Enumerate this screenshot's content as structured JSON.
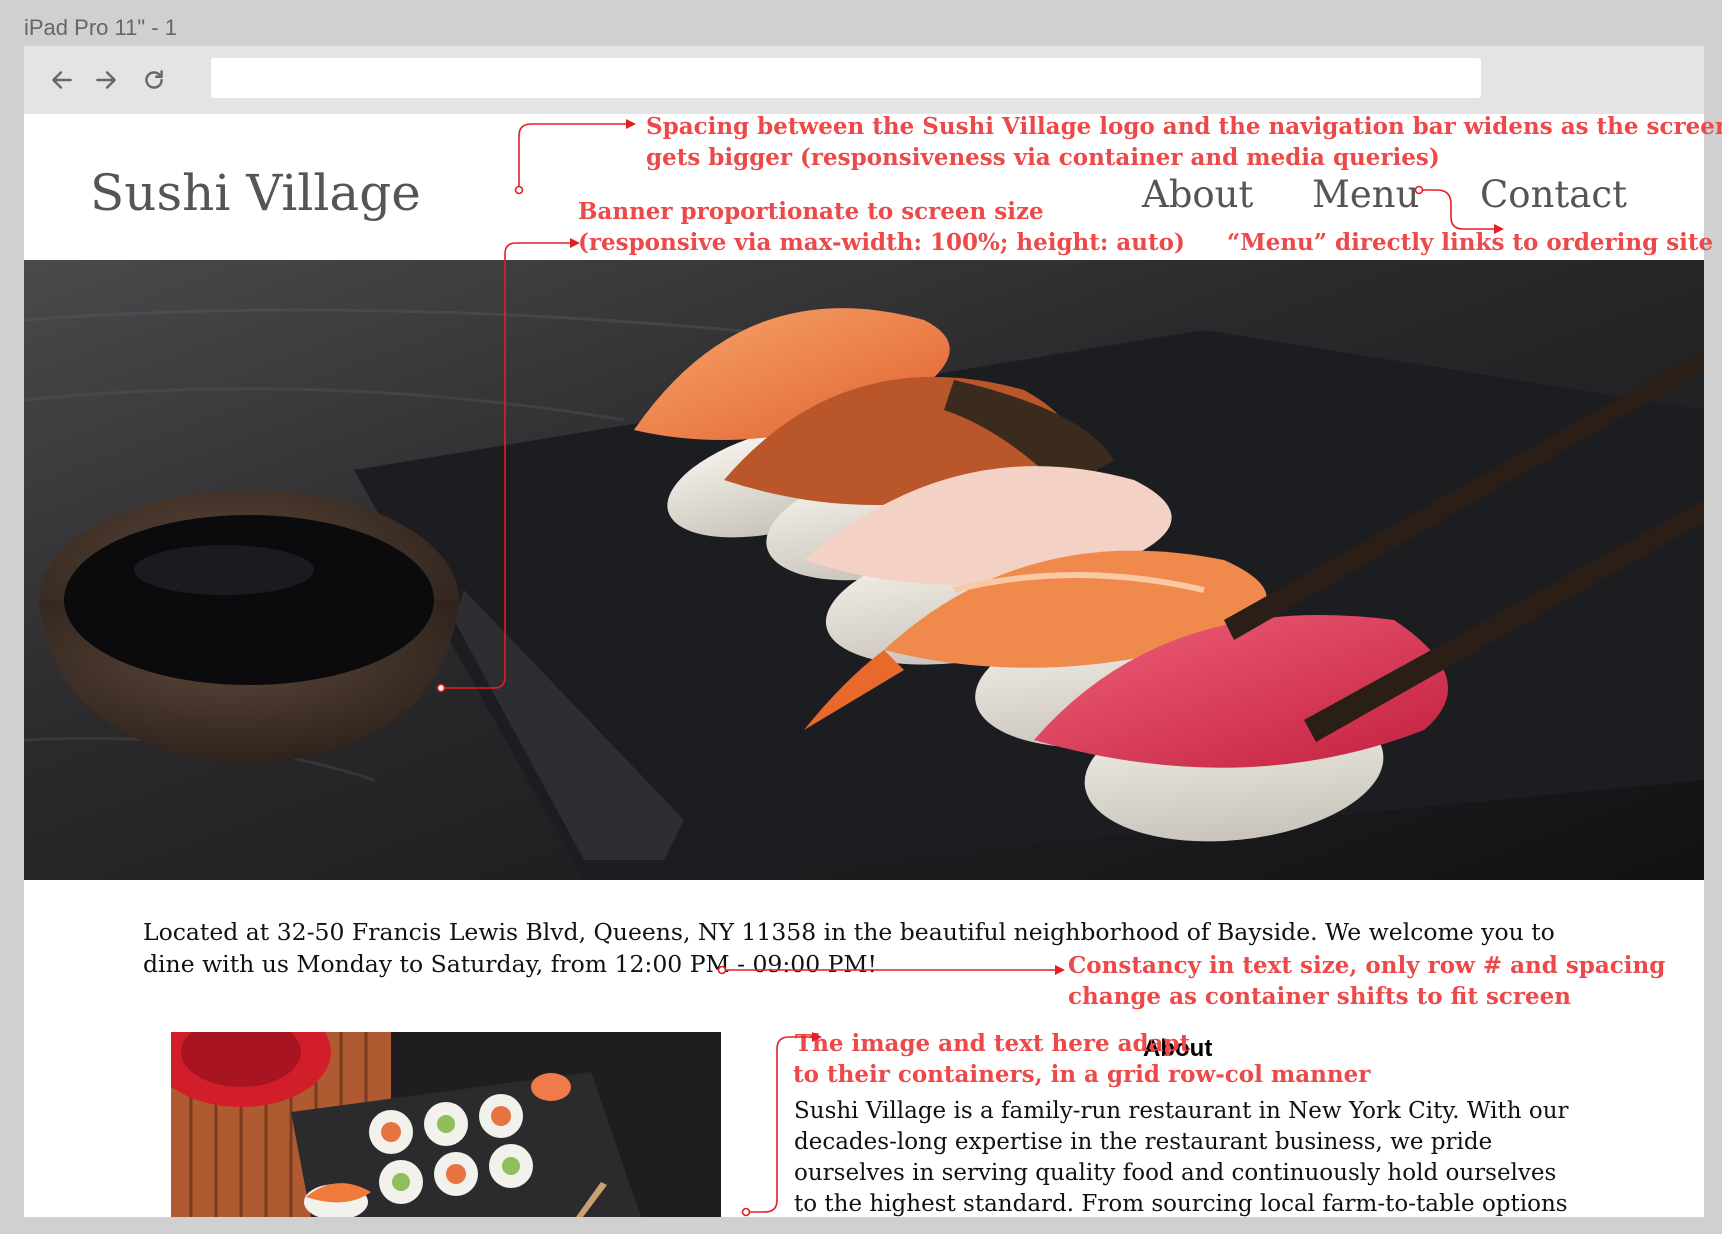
{
  "frame": {
    "title": "iPad Pro 11\" - 1"
  },
  "browser": {
    "back_icon": "arrow-left-icon",
    "forward_icon": "arrow-right-icon",
    "reload_icon": "reload-icon",
    "url": ""
  },
  "site": {
    "logo": "Sushi Village",
    "nav": [
      "About",
      "Menu",
      "Contact"
    ],
    "intro_text": "Located at 32-50 Francis Lewis Blvd, Queens, NY 11358 in the  beautiful neighborhood of Bayside. We welcome you to dine with us Monday to Saturday, from 12:00 PM - 09:00 PM!",
    "about_heading": "About",
    "about_text": "Sushi Village is a family-run restaurant in New York City. With our decades-long expertise in the restaurant business, we pride ourselves in serving quality food and continuously hold ourselves to the highest standard. From sourcing local farm-to-table options to"
  },
  "annotations": {
    "spacing_line1": "Spacing between the Sushi Village logo and the navigation bar widens as the screen",
    "spacing_line2": "gets bigger (responsiveness via container and media queries)",
    "banner_line1": "Banner proportionate to screen size",
    "banner_line2": "(responsive via max-width: 100%; height: auto)",
    "menu_note": "“Menu” directly links to ordering site",
    "text_line1": "Constancy in text size, only row # and spacing",
    "text_line2": "change as container shifts to fit screen",
    "grid_line1": "The image and text here adapt",
    "grid_line2": "to their containers, in a grid row-col manner"
  },
  "colors": {
    "annotation": "#ec4a4a",
    "frame_bg": "#d0d0d0",
    "nav_text": "#555555"
  }
}
